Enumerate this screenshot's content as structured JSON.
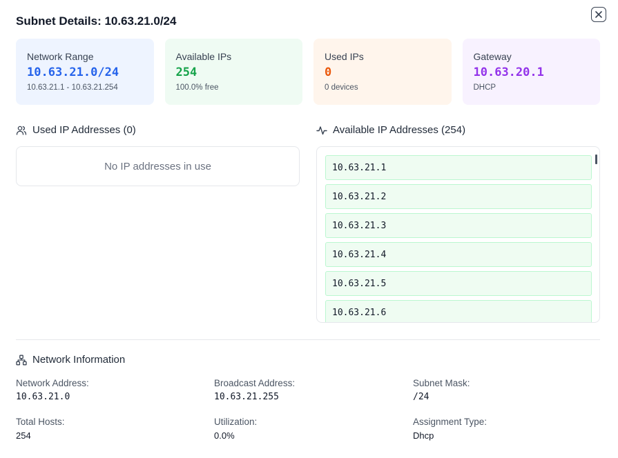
{
  "title": "Subnet Details: 10.63.21.0/24",
  "close_icon": "close-icon",
  "cards": {
    "network_range": {
      "label": "Network Range",
      "value": "10.63.21.0/24",
      "sub": "10.63.21.1 - 10.63.21.254",
      "color": "#2563eb"
    },
    "available": {
      "label": "Available IPs",
      "value": "254",
      "sub": "100.0% free",
      "color": "#16a34a"
    },
    "used": {
      "label": "Used IPs",
      "value": "0",
      "sub": "0 devices",
      "color": "#ea580c"
    },
    "gateway": {
      "label": "Gateway",
      "value": "10.63.20.1",
      "sub": "DHCP",
      "color": "#9333ea"
    }
  },
  "used_section": {
    "icon": "users-icon",
    "heading": "Used IP Addresses (0)",
    "empty_text": "No IP addresses in use"
  },
  "available_section": {
    "icon": "activity-icon",
    "heading": "Available IP Addresses (254)",
    "items": [
      "10.63.21.1",
      "10.63.21.2",
      "10.63.21.3",
      "10.63.21.4",
      "10.63.21.5",
      "10.63.21.6"
    ]
  },
  "network_info": {
    "icon": "network-icon",
    "heading": "Network Information",
    "fields": {
      "network_address": {
        "label": "Network Address:",
        "value": "10.63.21.0"
      },
      "broadcast_address": {
        "label": "Broadcast Address:",
        "value": "10.63.21.255"
      },
      "subnet_mask": {
        "label": "Subnet Mask:",
        "value": "/24"
      },
      "total_hosts": {
        "label": "Total Hosts:",
        "value": "254"
      },
      "utilization": {
        "label": "Utilization:",
        "value": "0.0%"
      },
      "assignment_type": {
        "label": "Assignment Type:",
        "value": "Dhcp"
      }
    }
  }
}
